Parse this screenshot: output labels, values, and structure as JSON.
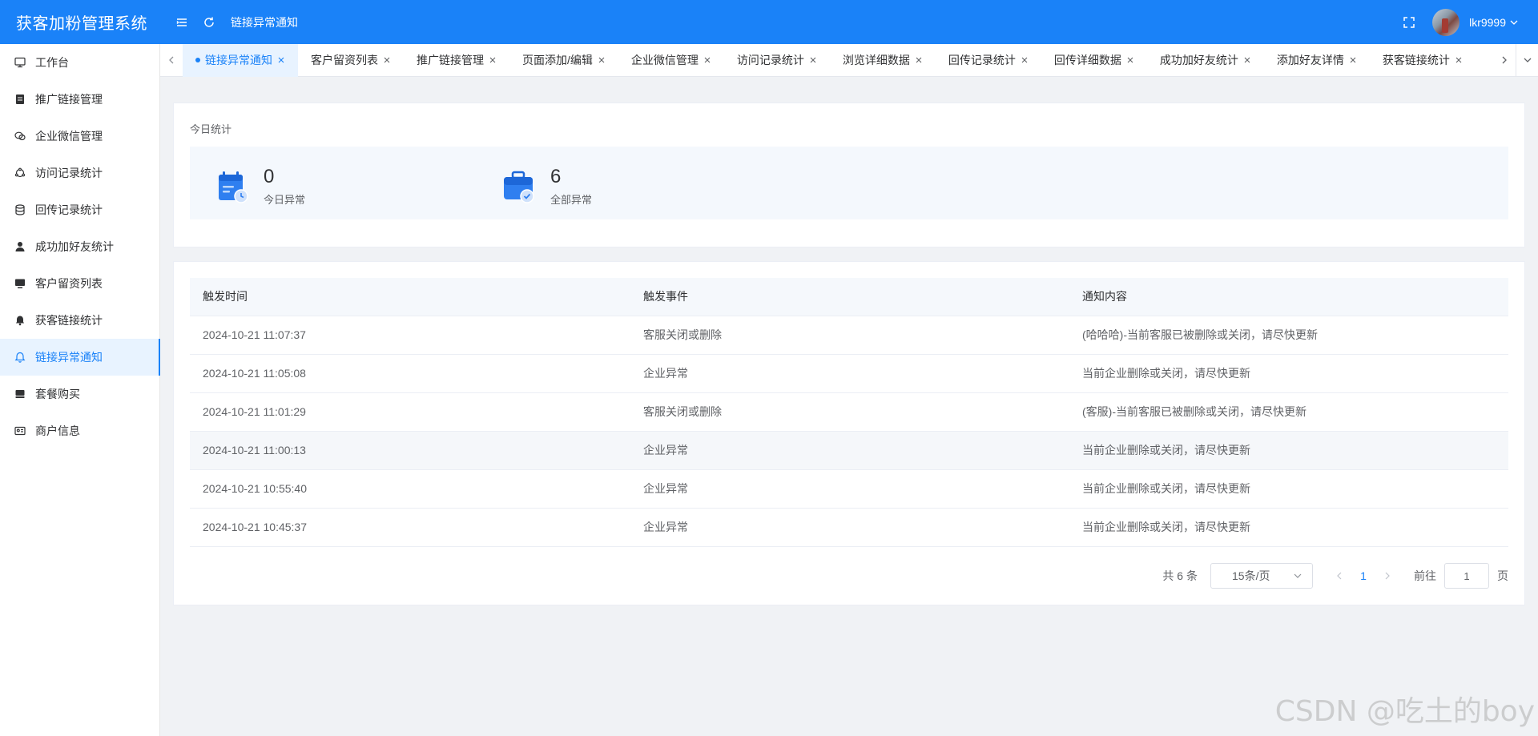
{
  "header": {
    "brand": "获客加粉管理系统",
    "current_page": "链接异常通知",
    "username": "lkr9999"
  },
  "sidebar": {
    "items": [
      {
        "label": "工作台",
        "icon": "monitor-icon"
      },
      {
        "label": "推广链接管理",
        "icon": "document-icon"
      },
      {
        "label": "企业微信管理",
        "icon": "chat-icon"
      },
      {
        "label": "访问记录统计",
        "icon": "cycle-icon"
      },
      {
        "label": "回传记录统计",
        "icon": "database-icon"
      },
      {
        "label": "成功加好友统计",
        "icon": "user-icon"
      },
      {
        "label": "客户留资列表",
        "icon": "screen-icon"
      },
      {
        "label": "获客链接统计",
        "icon": "bell-filled-icon"
      },
      {
        "label": "链接异常通知",
        "icon": "bell-icon",
        "active": true
      },
      {
        "label": "套餐购买",
        "icon": "box-icon"
      },
      {
        "label": "商户信息",
        "icon": "id-card-icon"
      }
    ]
  },
  "tabs": [
    {
      "label": "链接异常通知",
      "active": true
    },
    {
      "label": "客户留资列表"
    },
    {
      "label": "推广链接管理"
    },
    {
      "label": "页面添加/编辑"
    },
    {
      "label": "企业微信管理"
    },
    {
      "label": "访问记录统计"
    },
    {
      "label": "浏览详细数据"
    },
    {
      "label": "回传记录统计"
    },
    {
      "label": "回传详细数据"
    },
    {
      "label": "成功加好友统计"
    },
    {
      "label": "添加好友详情"
    },
    {
      "label": "获客链接统计"
    }
  ],
  "stats": {
    "title": "今日统计",
    "today": {
      "value": "0",
      "label": "今日异常"
    },
    "all": {
      "value": "6",
      "label": "全部异常"
    }
  },
  "table": {
    "columns": [
      "触发时间",
      "触发事件",
      "通知内容"
    ],
    "rows": [
      [
        "2024-10-21 11:07:37",
        "客服关闭或删除",
        "(哈哈哈)-当前客服已被删除或关闭，请尽快更新"
      ],
      [
        "2024-10-21 11:05:08",
        "企业异常",
        "当前企业删除或关闭，请尽快更新"
      ],
      [
        "2024-10-21 11:01:29",
        "客服关闭或删除",
        "(客服)-当前客服已被删除或关闭，请尽快更新"
      ],
      [
        "2024-10-21 11:00:13",
        "企业异常",
        "当前企业删除或关闭，请尽快更新"
      ],
      [
        "2024-10-21 10:55:40",
        "企业异常",
        "当前企业删除或关闭，请尽快更新"
      ],
      [
        "2024-10-21 10:45:37",
        "企业异常",
        "当前企业删除或关闭，请尽快更新"
      ]
    ]
  },
  "pagination": {
    "total": "共 6 条",
    "page_size": "15条/页",
    "current_page": "1",
    "goto_label": "前往",
    "goto_value": "1",
    "goto_suffix": "页"
  },
  "watermark": "CSDN @吃土的boy",
  "colors": {
    "primary": "#1a82f8",
    "active_bg": "#e8f3ff"
  }
}
